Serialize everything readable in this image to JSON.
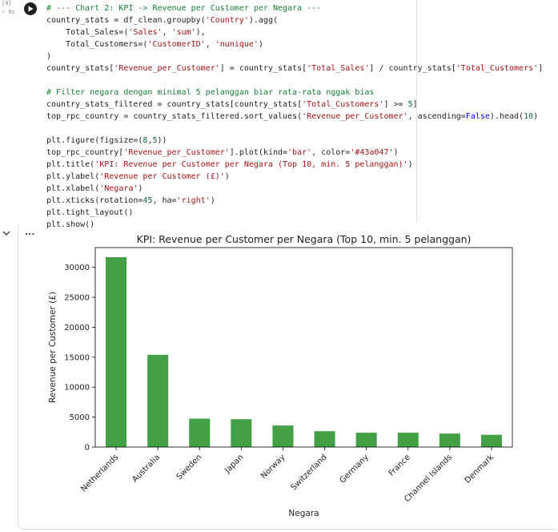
{
  "cell": {
    "exec_count": "[9]",
    "exec_status": "✓ 0s",
    "code_lines": [
      "# --- Chart 2: KPI -> Revenue per Customer per Negara ---",
      "country_stats = df_clean.groupby('Country').agg(",
      "    Total_Sales=('Sales', 'sum'),",
      "    Total_Customers=('CustomerID', 'nunique')",
      ")",
      "country_stats['Revenue_per_Customer'] = country_stats['Total_Sales'] / country_stats['Total_Customers']",
      "",
      "# Filter negara dengan minimal 5 pelanggan biar rata-rata nggak bias",
      "country_stats_filtered = country_stats[country_stats['Total_Customers'] >= 5]",
      "top_rpc_country = country_stats_filtered.sort_values('Revenue_per_Customer', ascending=False).head(10)",
      "",
      "plt.figure(figsize=(8,5))",
      "top_rpc_country['Revenue_per_Customer'].plot(kind='bar', color='#43a047')",
      "plt.title('KPI: Revenue per Customer per Negara (Top 10, min. 5 pelanggan)')",
      "plt.ylabel('Revenue per Customer (£)')",
      "plt.xlabel('Negara')",
      "plt.xticks(rotation=45, ha='right')",
      "plt.tight_layout()",
      "plt.show()"
    ]
  },
  "output": {
    "more_label": "..."
  },
  "chart_data": {
    "type": "bar",
    "title": "KPI: Revenue per Customer per Negara (Top 10, min. 5 pelanggan)",
    "xlabel": "Negara",
    "ylabel": "Revenue per Customer (£)",
    "categories": [
      "Netherlands",
      "Australia",
      "Sweden",
      "Japan",
      "Norway",
      "Switzerland",
      "Germany",
      "France",
      "Channel Islands",
      "Denmark"
    ],
    "values": [
      31700,
      15400,
      4750,
      4650,
      3600,
      2650,
      2400,
      2400,
      2250,
      2050
    ],
    "ylim": [
      0,
      33300
    ],
    "yticks": [
      0,
      5000,
      10000,
      15000,
      20000,
      25000,
      30000
    ],
    "bar_color": "#43a047",
    "grid": false,
    "legend": false
  }
}
